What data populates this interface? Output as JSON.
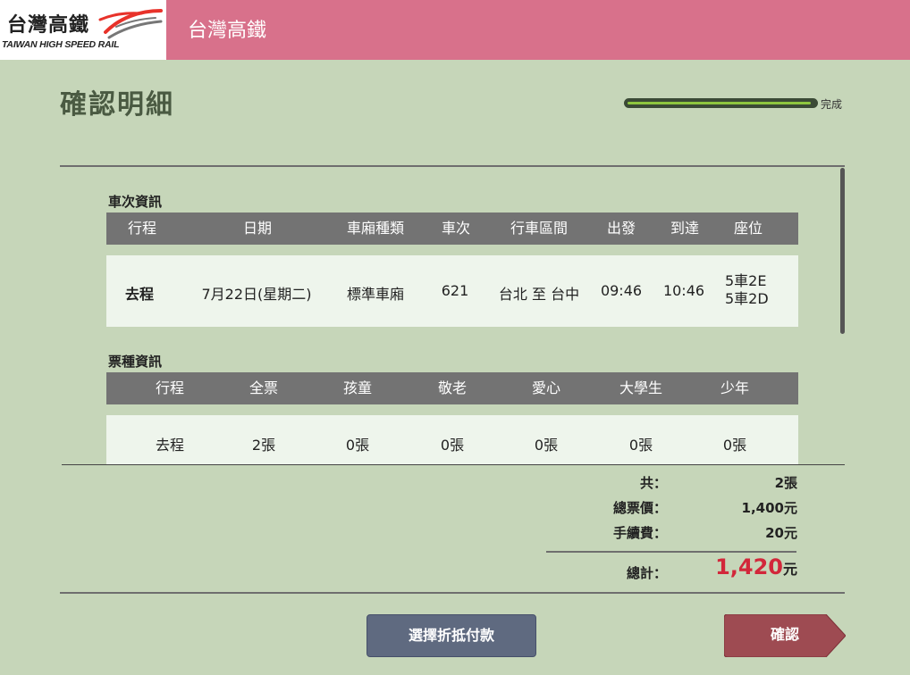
{
  "header": {
    "logo_zh": "台灣高鐵",
    "logo_en": "TAIWAN HIGH SPEED RAIL",
    "title": "台灣高鐵"
  },
  "page": {
    "title": "確認明細",
    "progress_label": "完成",
    "progress_fraction": 1.0
  },
  "train_info": {
    "section_title": "車次資訊",
    "headers": [
      "行程",
      "日期",
      "車廂種類",
      "車次",
      "行車區間",
      "出發",
      "到達",
      "座位"
    ],
    "row": {
      "trip": "去程",
      "date": "7月22日(星期二)",
      "car_type": "標準車廂",
      "train_no": "621",
      "route": "台北 至 台中",
      "depart": "09:46",
      "arrive": "10:46",
      "seats": [
        "5車2E",
        "5車2D"
      ]
    }
  },
  "ticket_info": {
    "section_title": "票種資訊",
    "headers": [
      "行程",
      "全票",
      "孩童",
      "敬老",
      "愛心",
      "大學生",
      "少年"
    ],
    "row": [
      "去程",
      "2張",
      "0張",
      "0張",
      "0張",
      "0張",
      "0張"
    ]
  },
  "summary": {
    "count_label": "共：",
    "count_value": "2張",
    "fare_label": "總票價：",
    "fare_value": "1,400元",
    "fee_label": "手續費：",
    "fee_value": "20元",
    "total_label": "總計：",
    "total_amount": "1,420",
    "total_unit": "元"
  },
  "buttons": {
    "pay_label": "選擇折抵付款",
    "confirm_label": "確認"
  },
  "colors": {
    "header": "#d8718b",
    "background": "#c6d6b9",
    "table_header": "#737373",
    "row_bg": "#eef5ec",
    "progress": "#8ec63f",
    "total": "#d2273a",
    "pay_button": "#5f6a80",
    "confirm_button": "#9e4b52"
  }
}
